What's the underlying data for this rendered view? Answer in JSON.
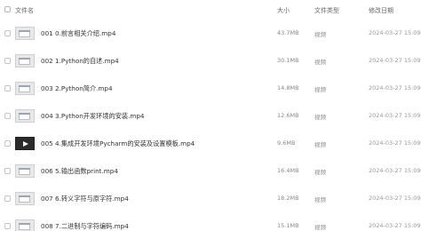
{
  "header": {
    "name": "文件名",
    "size": "大小",
    "type": "文件类型",
    "date": "修改日期"
  },
  "files": [
    {
      "name": "001 0.前言相关介绍.mp4",
      "size": "43.7MB",
      "type": "视频",
      "date": "2024-03-27 15:09",
      "thumb": "screen"
    },
    {
      "name": "002 1.Python的自述.mp4",
      "size": "30.1MB",
      "type": "视频",
      "date": "2024-03-27 15:09",
      "thumb": "screen"
    },
    {
      "name": "003 2.Python简介.mp4",
      "size": "14.8MB",
      "type": "视频",
      "date": "2024-03-27 15:09",
      "thumb": "screen"
    },
    {
      "name": "004 3.Python开发环境的安装.mp4",
      "size": "12.6MB",
      "type": "视频",
      "date": "2024-03-27 15:09",
      "thumb": "screen"
    },
    {
      "name": "005 4.集成开发环境Pycharm的安装及设置模板.mp4",
      "size": "9.6MB",
      "type": "视频",
      "date": "2024-03-27 15:09",
      "thumb": "play"
    },
    {
      "name": "006 5.输出函数print.mp4",
      "size": "16.4MB",
      "type": "视频",
      "date": "2024-03-27 15:09",
      "thumb": "screen"
    },
    {
      "name": "007 6.转义字符与原字符.mp4",
      "size": "18.2MB",
      "type": "视频",
      "date": "2024-03-27 15:09",
      "thumb": "screen"
    },
    {
      "name": "008 7.二进制与字符编码.mp4",
      "size": "15.1MB",
      "type": "视频",
      "date": "2024-03-27 15:09",
      "thumb": "screen"
    }
  ]
}
